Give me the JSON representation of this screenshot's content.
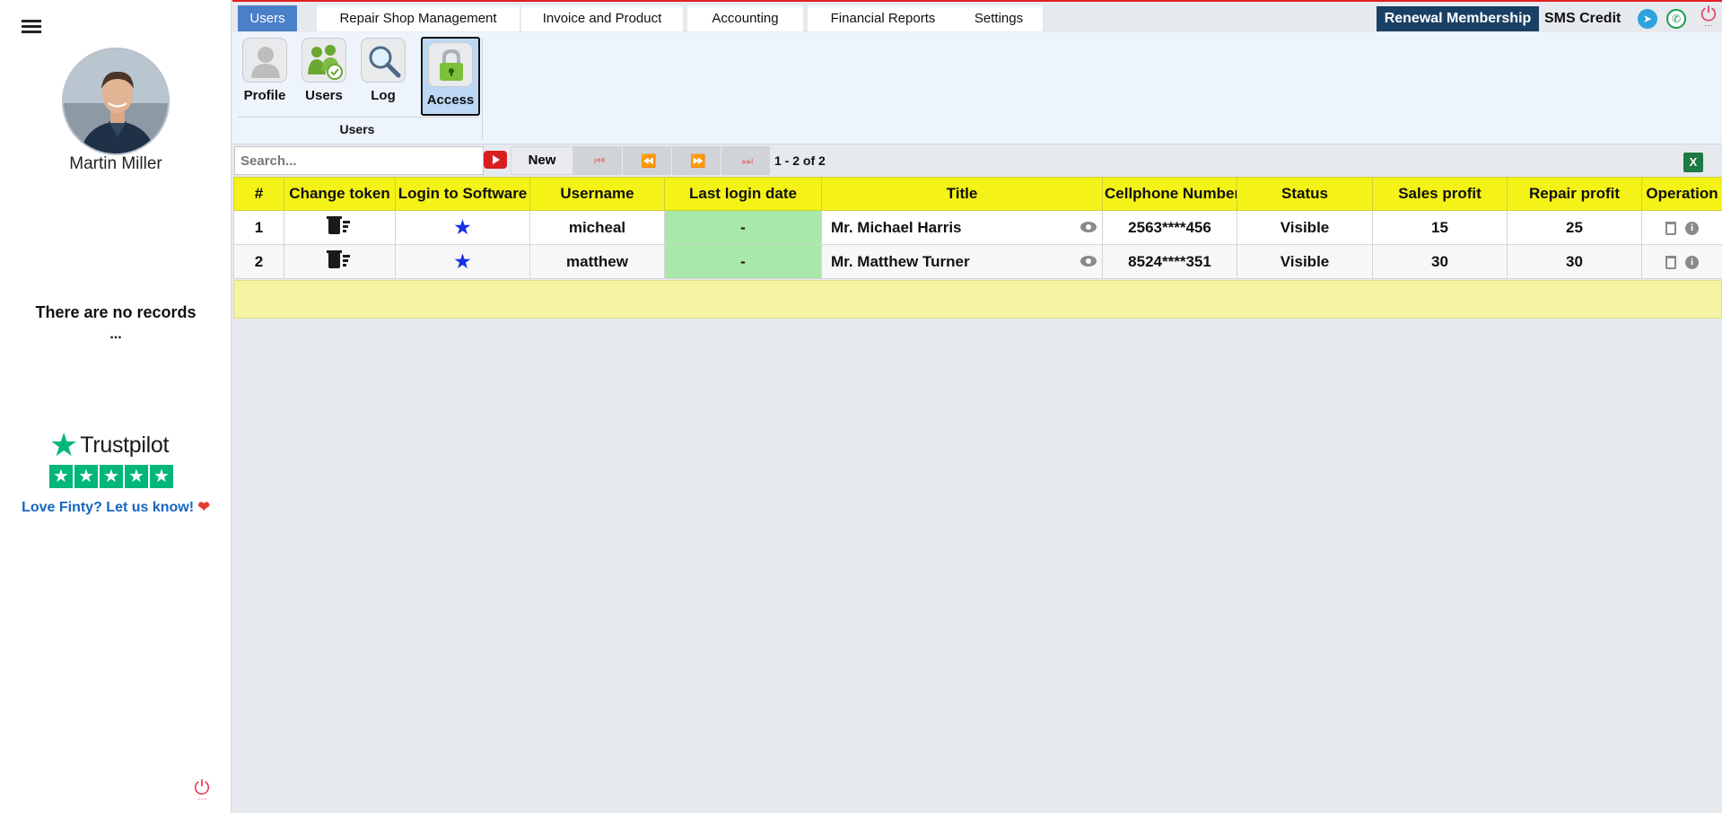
{
  "sidebar": {
    "user_name": "Martin Miller",
    "no_records": "There are no records",
    "no_records_dots": "...",
    "trustpilot": {
      "wordmark": "Trustpilot",
      "stars": 5
    },
    "love_finty": "Love Finty? Let us know!"
  },
  "topbar": {
    "tabs": [
      {
        "label": "Users",
        "active": true
      },
      {
        "label": "Repair Shop Management",
        "active": false
      },
      {
        "label": "Invoice and Product",
        "active": false
      },
      {
        "label": "Accounting",
        "active": false
      },
      {
        "label": "Financial Reports",
        "active": false
      },
      {
        "label": "Settings",
        "active": false
      }
    ],
    "renewal_label": "Renewal Membership",
    "sms_label": "SMS Credit",
    "icons": [
      "telegram-icon",
      "whatsapp-icon",
      "power-icon"
    ]
  },
  "ribbon": {
    "buttons": [
      {
        "label": "Profile",
        "icon": "profile-icon"
      },
      {
        "label": "Users",
        "icon": "users-icon"
      },
      {
        "label": "Log",
        "icon": "magnifier-icon"
      },
      {
        "label": "Access",
        "icon": "lock-icon",
        "active": true
      }
    ],
    "group_label": "Users"
  },
  "toolbar": {
    "search_placeholder": "Search...",
    "new_label": "New",
    "pager_text": "1 - 2 of 2"
  },
  "table": {
    "columns": [
      "#",
      "Change token",
      "Login to Software",
      "Username",
      "Last login date",
      "Title",
      "Cellphone Number",
      "Status",
      "Sales profit",
      "Repair profit",
      "Operation"
    ],
    "rows": [
      {
        "num": "1",
        "username": "micheal",
        "last_login": "-",
        "title": "Mr. Michael Harris",
        "cellphone": "2563****456",
        "status": "Visible",
        "sales_profit": "15",
        "repair_profit": "25"
      },
      {
        "num": "2",
        "username": "matthew",
        "last_login": "-",
        "title": "Mr. Matthew Turner",
        "cellphone": "8524****351",
        "status": "Visible",
        "sales_profit": "30",
        "repair_profit": "30"
      }
    ]
  },
  "colors": {
    "active_tab": "#4a80c8",
    "renewal_bg": "#1a3f64",
    "header_yellow": "#f4f216",
    "login_green": "#a8e8a8",
    "top_border_red": "#e02020",
    "trustpilot_green": "#00b67a"
  }
}
